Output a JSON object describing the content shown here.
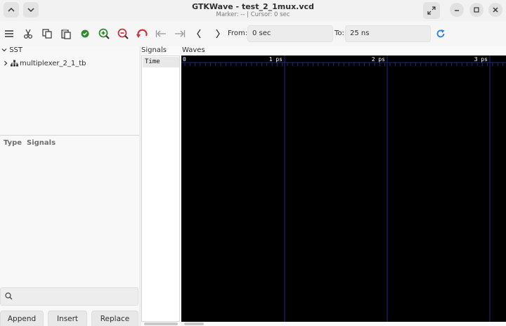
{
  "window": {
    "title": "GTKWave - test_2_1mux.vcd",
    "subtitle": "Marker: --  |  Cursor: 0 sec"
  },
  "toolbar": {
    "from_label": "From:",
    "from_value": "0 sec",
    "to_label": "To:",
    "to_value": "25 ns"
  },
  "sst": {
    "label": "SST",
    "tree": [
      {
        "label": "multiplexer_2_1_tb"
      }
    ],
    "columns": {
      "type": "Type",
      "signals": "Signals"
    }
  },
  "buttons": {
    "append": "Append",
    "insert": "Insert",
    "replace": "Replace"
  },
  "signals_panel": {
    "title": "Signals",
    "rows": [
      "Time"
    ]
  },
  "waves_panel": {
    "title": "Waves",
    "ticks": [
      {
        "label": "0"
      },
      {
        "label": "1 ps"
      },
      {
        "label": "2 ps"
      },
      {
        "label": "3 ps"
      }
    ]
  },
  "colors": {
    "wave_background": "#000000",
    "grid_line": "#1e2a78",
    "tick_label": "#ffffff",
    "zoom_icon": "#2e8b2e",
    "undo_icon": "#d0303a",
    "reload_icon": "#2f7ed8"
  }
}
